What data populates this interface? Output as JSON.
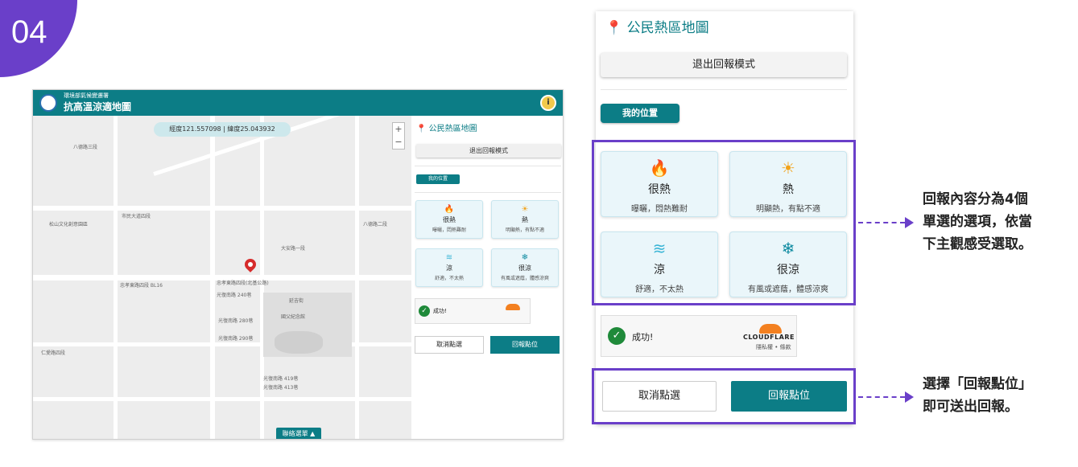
{
  "step": "04",
  "app": {
    "org": "環境部氣候變遷署",
    "title": "抗高溫涼適地圖",
    "info_icon": "info-icon"
  },
  "map": {
    "coordinates": "經度121.557098 | 緯度25.043932",
    "zoom_in": "+",
    "zoom_out": "−",
    "contact_button": "聯絡選單 ▲",
    "labels": [
      "八德路三段",
      "光復南路 280巷",
      "光復南路 290巷",
      "市民大道四段",
      "忠孝東路四段(北基公路)",
      "延吉街",
      "仁愛路四段",
      "大安路一段",
      "松山文化創意園區",
      "忠孝東路四段 BL16",
      "光復南路 240巷",
      "光復南路 419巷",
      "光復南路 413巷",
      "國父紀念館",
      "八德路二段"
    ]
  },
  "panel_small": {
    "title": "公民熱區地圖",
    "exit": "退出回報模式",
    "my_location": "我的位置",
    "cards": [
      {
        "title": "很熱",
        "desc": "曝曬，悶熱難耐"
      },
      {
        "title": "熱",
        "desc": "明顯熱，有點不適"
      },
      {
        "title": "涼",
        "desc": "舒適，不太熱"
      },
      {
        "title": "很涼",
        "desc": "有風或遮蔭，體感涼爽"
      }
    ],
    "cf_status": "成功!",
    "cancel": "取消點選",
    "report": "回報點位"
  },
  "panel_zoom": {
    "title": "公民熱區地圖",
    "exit": "退出回報模式",
    "my_location": "我的位置",
    "cards": [
      {
        "title": "很熱",
        "desc": "曝曬，悶熱難耐",
        "icon": "flame-icon"
      },
      {
        "title": "熱",
        "desc": "明顯熱，有點不適",
        "icon": "sun-icon"
      },
      {
        "title": "涼",
        "desc": "舒適，不太熱",
        "icon": "wind-icon"
      },
      {
        "title": "很涼",
        "desc": "有風或遮蔭，體感涼爽",
        "icon": "snowflake-icon"
      }
    ],
    "cf_status": "成功!",
    "cf_brand": "CLOUDFLARE",
    "cf_links": "隱私權 • 條款",
    "cancel": "取消點選",
    "report": "回報點位"
  },
  "callouts": {
    "options_line1": "回報內容分為4個",
    "options_line2": "單選的選項，依當",
    "options_line3": "下主觀感受選取。",
    "submit_line1": "選擇「回報點位」",
    "submit_line2": "即可送出回報。"
  },
  "colors": {
    "accent": "#0c7d86",
    "highlight": "#6a3fc9",
    "hot": "#d62b2b",
    "warm": "#f2a21a",
    "cool": "#3ab5d6",
    "cold": "#0e8aa0"
  }
}
